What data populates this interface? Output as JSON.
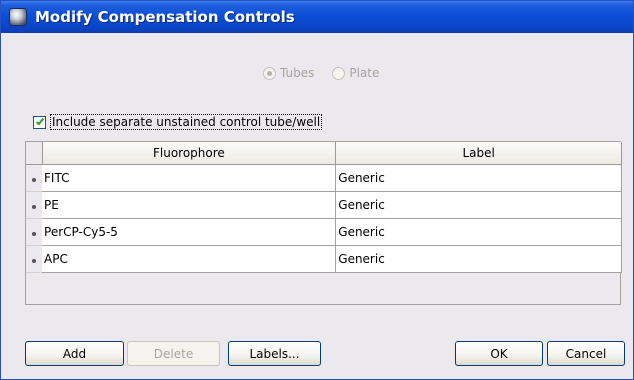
{
  "window": {
    "title": "Modify Compensation Controls",
    "title_icon": "app-orb-icon"
  },
  "mode": {
    "options": [
      {
        "label": "Tubes",
        "selected": true,
        "enabled": false
      },
      {
        "label": "Plate",
        "selected": false,
        "enabled": false
      }
    ]
  },
  "unstained": {
    "label": "Include separate unstained control tube/well",
    "checked": true
  },
  "table": {
    "columns": [
      "Fluorophore",
      "Label"
    ],
    "rows": [
      {
        "fluorophore": "FITC",
        "label": "Generic"
      },
      {
        "fluorophore": "PE",
        "label": "Generic"
      },
      {
        "fluorophore": "PerCP-Cy5-5",
        "label": "Generic"
      },
      {
        "fluorophore": "APC",
        "label": "Generic"
      }
    ]
  },
  "buttons": {
    "add": "Add",
    "delete": "Delete",
    "labels": "Labels...",
    "ok": "OK",
    "cancel": "Cancel"
  },
  "colors": {
    "titlebar": "#0a47cc",
    "dialog_bg": "#ebe9ed",
    "check": "#21a121"
  }
}
